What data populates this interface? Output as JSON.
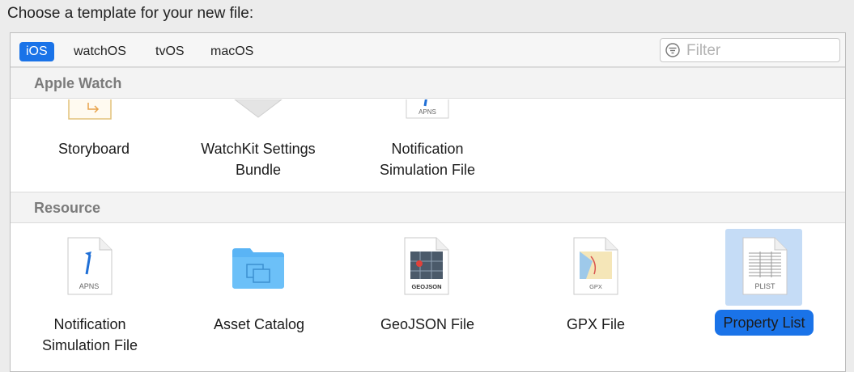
{
  "prompt": "Choose a template for your new file:",
  "tabs": [
    {
      "label": "iOS",
      "active": true
    },
    {
      "label": "watchOS",
      "active": false
    },
    {
      "label": "tvOS",
      "active": false
    },
    {
      "label": "macOS",
      "active": false
    }
  ],
  "filter": {
    "placeholder": "Filter",
    "value": ""
  },
  "sections": [
    {
      "title": "Apple Watch",
      "items": [
        {
          "label_lines": [
            "Storyboard"
          ],
          "icon": "storyboard-icon"
        },
        {
          "label_lines": [
            "WatchKit Settings",
            "Bundle"
          ],
          "icon": "settings-bundle-icon"
        },
        {
          "label_lines": [
            "Notification",
            "Simulation File"
          ],
          "icon": "apns-file-icon",
          "icon_text": "APNS"
        }
      ]
    },
    {
      "title": "Resource",
      "items": [
        {
          "label_lines": [
            "Notification",
            "Simulation File"
          ],
          "icon": "apns-file-icon",
          "icon_text": "APNS"
        },
        {
          "label_lines": [
            "Asset Catalog"
          ],
          "icon": "folder-icon"
        },
        {
          "label_lines": [
            "GeoJSON File"
          ],
          "icon": "geojson-file-icon",
          "icon_text": "GEOJSON"
        },
        {
          "label_lines": [
            "GPX File"
          ],
          "icon": "gpx-file-icon",
          "icon_text": "GPX"
        },
        {
          "label_lines": [
            "Property List"
          ],
          "icon": "plist-file-icon",
          "icon_text": "PLIST",
          "selected": true
        }
      ]
    }
  ],
  "colors": {
    "accent": "#1a73e8",
    "selection_bg": "#c5dcf6",
    "folder": "#5ab4f5"
  }
}
